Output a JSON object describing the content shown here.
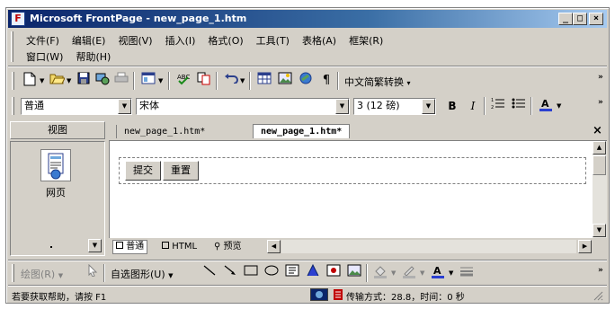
{
  "window": {
    "title": "Microsoft FrontPage - new_page_1.htm",
    "app_icon": "frontpage-icon",
    "controls": [
      "_",
      "□",
      "×"
    ]
  },
  "menu": {
    "row1": [
      "文件(F)",
      "编辑(E)",
      "视图(V)",
      "插入(I)",
      "格式(O)",
      "工具(T)",
      "表格(A)",
      "框架(R)"
    ],
    "row2": [
      "窗口(W)",
      "帮助(H)"
    ]
  },
  "toolbar_standard": {
    "icons": [
      "new-page-icon",
      "open-icon",
      "save-icon",
      "publish-icon",
      "print-icon",
      "folder-list-icon",
      "spelling-icon",
      "copy-icon",
      "undo-icon",
      "insert-table-icon",
      "insert-picture-icon",
      "hyperlink-icon",
      "show-all-icon"
    ],
    "pilcrow": "¶",
    "conversion_label": "中文简繁转换",
    "conversion_arrow": "▾",
    "overflow": "»"
  },
  "toolbar_formatting": {
    "style_value": "普通",
    "font_value": "宋体",
    "size_value": "3  (12 磅)",
    "bold": "B",
    "italic": "I",
    "overflow": "»"
  },
  "views_panel": {
    "header": "视图",
    "page_label": "网页"
  },
  "document_tabs": [
    {
      "label": "new_page_1.htm*",
      "active": false
    },
    {
      "label": "new_page_1.htm*",
      "active": true
    }
  ],
  "document_close": "×",
  "form": {
    "submit_label": "提交",
    "reset_label": "重置"
  },
  "view_tabs": [
    {
      "label": "普通",
      "active": true
    },
    {
      "label": "HTML",
      "active": false
    },
    {
      "label": "预览",
      "active": false
    }
  ],
  "drawing_toolbar": {
    "draw_label": "绘图(R)",
    "autoshapes_label": "自选图形(U)",
    "overflow": "»"
  },
  "status_bar": {
    "help_text": "若要获取帮助，请按 F1",
    "transfer_text": "传输方式：28.8，时间：0 秒"
  }
}
